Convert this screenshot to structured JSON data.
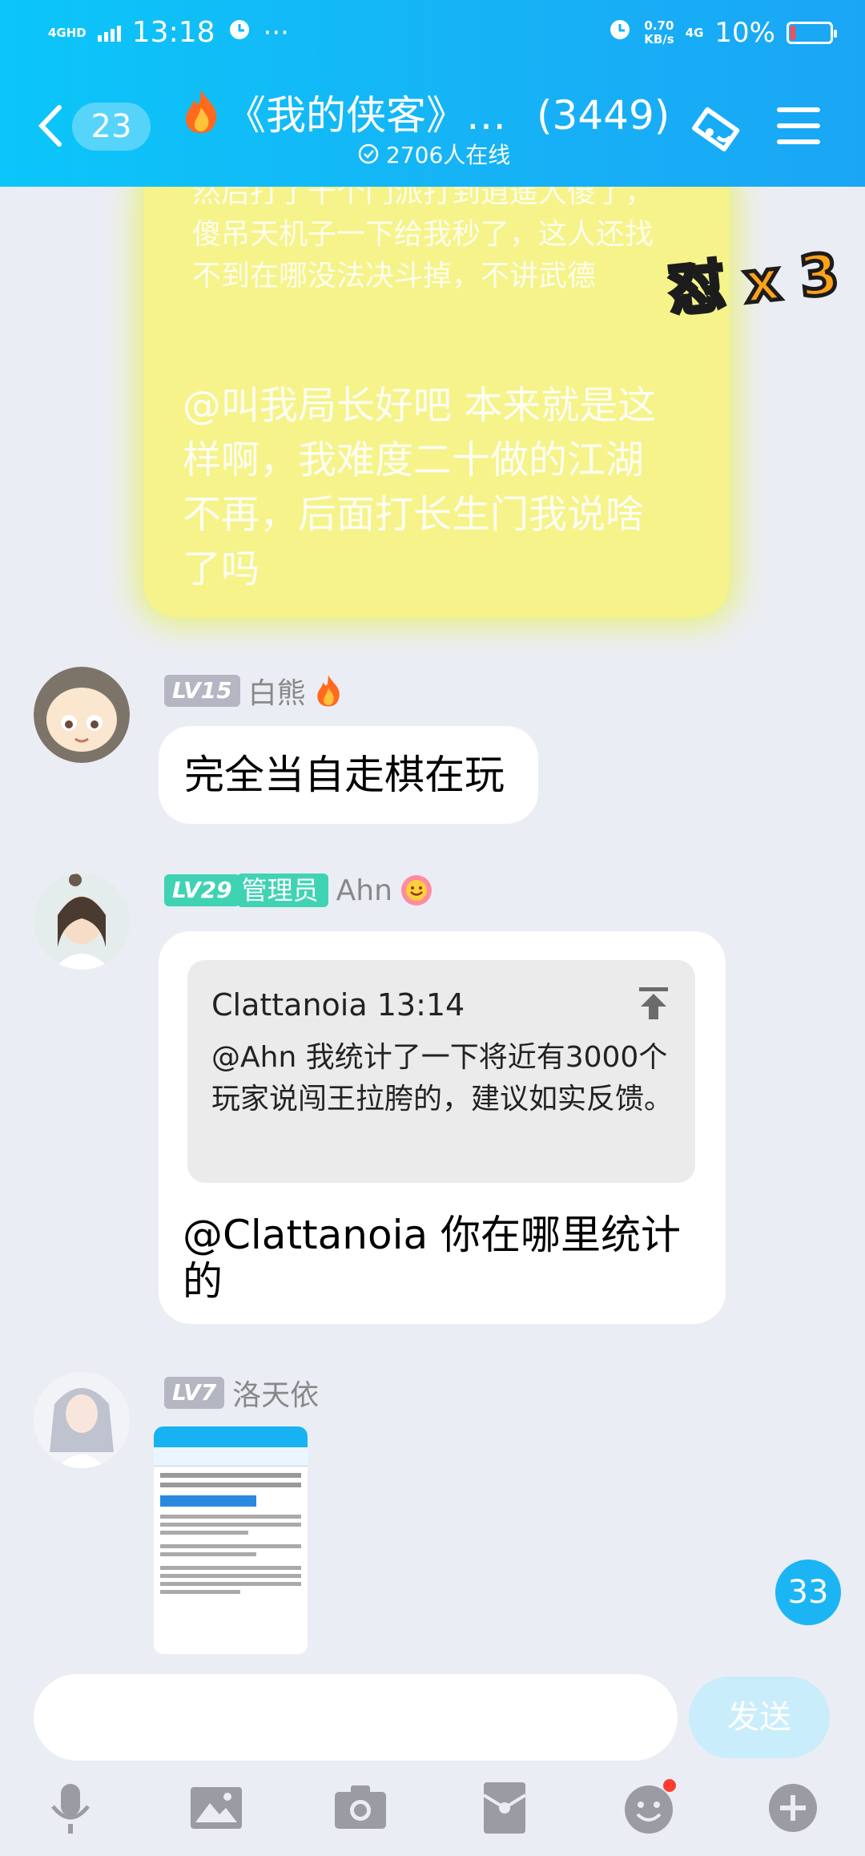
{
  "status_bar": {
    "network": "4GHD",
    "time": "13:18",
    "dots": "···",
    "speed_value": "0.70",
    "speed_unit": "KB/s",
    "mobile": "4G",
    "battery": "10%"
  },
  "header": {
    "back_count": "23",
    "title": "《我的侠客》…",
    "member_count": "(3449)",
    "online": "2706人在线"
  },
  "messages": {
    "blurred": {
      "quote_text": "然后打了十个门派打到逍遥人傻了，傻吊天机子一下给我秒了，这人还找不到在哪没法决斗掉，不讲武德",
      "text": "@叫我局长好吧  本来就是这样啊，我难度二十做的江湖不再，后面打长生门我说啥了吗",
      "sticker": "怼 x 3"
    },
    "m1": {
      "level": "LV15",
      "name": "白熊",
      "text": "完全当自走棋在玩"
    },
    "m2": {
      "level": "LV29",
      "role": "管理员",
      "name": "Ahn",
      "quote_author": "Clattanoia 13:14",
      "quote_text": "@Ahn 我统计了一下将近有3000个玩家说闯王拉胯的，建议如实反馈。",
      "text": "@Clattanoia 你在哪里统计的"
    },
    "m3": {
      "level": "LV7",
      "name": "洛天依"
    }
  },
  "unread_count": "33",
  "input": {
    "placeholder": "",
    "send_label": "发送"
  }
}
